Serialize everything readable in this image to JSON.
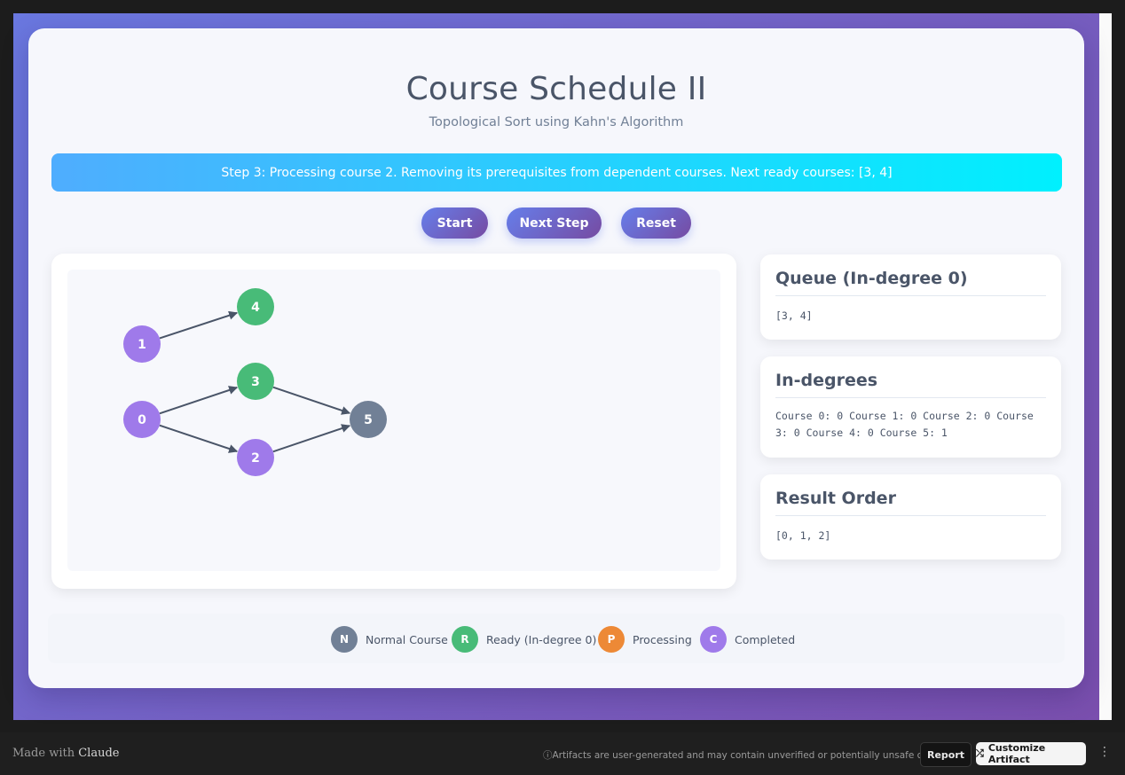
{
  "title": "Course Schedule II",
  "subtitle": "Topological Sort using Kahn's Algorithm",
  "status": "Step 3: Processing course 2. Removing its prerequisites from dependent courses. Next ready courses: [3, 4]",
  "buttons": {
    "start": "Start",
    "next": "Next Step",
    "reset": "Reset"
  },
  "colors": {
    "normal": "#718096",
    "ready": "#48bb78",
    "processing": "#ed8936",
    "completed": "#9f7aea",
    "edge": "#4a5568"
  },
  "graph": {
    "nodes": [
      {
        "id": "0",
        "label": "0",
        "state": "completed"
      },
      {
        "id": "1",
        "label": "1",
        "state": "completed"
      },
      {
        "id": "2",
        "label": "2",
        "state": "completed"
      },
      {
        "id": "3",
        "label": "3",
        "state": "ready"
      },
      {
        "id": "4",
        "label": "4",
        "state": "ready"
      },
      {
        "id": "5",
        "label": "5",
        "state": "normal"
      }
    ],
    "edges": [
      {
        "from": "1",
        "to": "4"
      },
      {
        "from": "0",
        "to": "3"
      },
      {
        "from": "0",
        "to": "2"
      },
      {
        "from": "3",
        "to": "5"
      },
      {
        "from": "2",
        "to": "5"
      }
    ]
  },
  "queue": {
    "title": "Queue (In-degree 0)",
    "value": "[3, 4]"
  },
  "indegrees": {
    "title": "In-degrees",
    "line1": "Course 0: 0 Course 1: 0 Course 2: 0 Course",
    "line2": "3: 0 Course 4: 0 Course 5: 1"
  },
  "result": {
    "title": "Result Order",
    "value": "[0, 1, 2]"
  },
  "legend": [
    {
      "letter": "N",
      "label": "Normal Course",
      "state": "normal"
    },
    {
      "letter": "R",
      "label": "Ready (In-degree 0)",
      "state": "ready"
    },
    {
      "letter": "P",
      "label": "Processing",
      "state": "processing"
    },
    {
      "letter": "C",
      "label": "Completed",
      "state": "completed"
    }
  ],
  "footer": {
    "made_prefix": "Made with",
    "made_brand": "Claude",
    "warning": "Artifacts are user-generated and may contain unverified or potentially unsafe content.",
    "report": "Report",
    "customize": "Customize Artifact"
  }
}
